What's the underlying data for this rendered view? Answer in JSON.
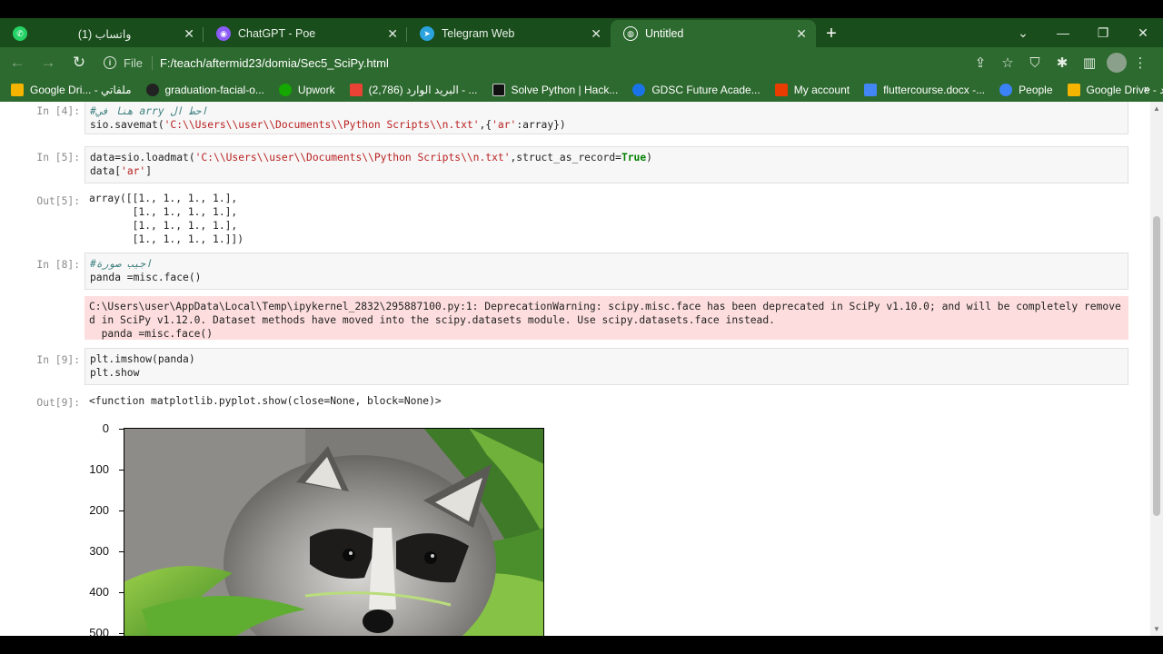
{
  "tabs": [
    {
      "label": "(1) واتساب",
      "icon": "whatsapp-icon",
      "color": "#25d366"
    },
    {
      "label": "ChatGPT - Poe",
      "icon": "poe-icon",
      "color": "#8b5cf6"
    },
    {
      "label": "Telegram Web",
      "icon": "telegram-icon",
      "color": "#2aa3df"
    },
    {
      "label": "Untitled",
      "icon": "globe-icon",
      "color": "#ffffff"
    }
  ],
  "tab_close": "✕",
  "new_tab": "+",
  "window": {
    "chevron": "⌄",
    "minimize": "—",
    "restore": "❐",
    "close": "✕"
  },
  "address": {
    "scheme": "File",
    "url": "F:/teach/aftermid23/domia/Sec5_SciPy.html"
  },
  "bookmarks": [
    {
      "label": "Google Dri... - ملفاتي",
      "icon": "google-drive-icon",
      "color": "#f4b400"
    },
    {
      "label": "graduation-facial-o...",
      "icon": "github-icon",
      "color": "#222222"
    },
    {
      "label": "Upwork",
      "icon": "upwork-icon",
      "color": "#14a800"
    },
    {
      "label": "(2,786) البريد الوارد - ...",
      "icon": "gmail-icon",
      "color": "#ea4335"
    },
    {
      "label": "Solve Python | Hack...",
      "icon": "hackerrank-icon",
      "color": "#111111"
    },
    {
      "label": "GDSC Future Acade...",
      "icon": "gdsc-icon",
      "color": "#1a73e8"
    },
    {
      "label": "My account",
      "icon": "office-icon",
      "color": "#eb3c00"
    },
    {
      "label": "fluttercourse.docx -...",
      "icon": "docs-icon",
      "color": "#4285f4"
    },
    {
      "label": "People",
      "icon": "people-icon",
      "color": "#3b82f6"
    },
    {
      "label": "Google Drive - مجلد",
      "icon": "google-drive-icon",
      "color": "#f4b400"
    }
  ],
  "bookmarks_more": "»",
  "cells": {
    "c4": {
      "prompt": "In [4]:",
      "comment": "#هنا في arry احط ال",
      "code_pre": "sio.savemat(",
      "str1": "'C:\\\\Users\\\\user\\\\Documents\\\\Python Scripts\\\\n.txt'",
      "code_mid": ",{",
      "str2": "'ar'",
      "code_post": ":array})"
    },
    "c5": {
      "prompt": "In [5]:",
      "code_pre": "data=sio.loadmat(",
      "str1": "'C:\\\\Users\\\\user\\\\Documents\\\\Python Scripts\\\\n.txt'",
      "code_mid": ",struct_as_record=",
      "kw": "True",
      "code_post": ")",
      "line2_pre": "data[",
      "line2_str": "'ar'",
      "line2_post": "]"
    },
    "o5": {
      "prompt": "Out[5]:",
      "text": "array([[1., 1., 1., 1.],\n       [1., 1., 1., 1.],\n       [1., 1., 1., 1.],\n       [1., 1., 1., 1.]])"
    },
    "c8": {
      "prompt": "In [8]:",
      "comment": "#اجيب صورة",
      "line2": "panda =misc.face()"
    },
    "e8": {
      "text": "C:\\Users\\user\\AppData\\Local\\Temp\\ipykernel_2832\\295887100.py:1: DeprecationWarning: scipy.misc.face has been deprecated in SciPy v1.10.0; and will be completely removed in SciPy v1.12.0. Dataset methods have moved into the scipy.datasets module. Use scipy.datasets.face instead.\n  panda =misc.face()"
    },
    "c9": {
      "prompt": "In [9]:",
      "text": "plt.imshow(panda)\nplt.show"
    },
    "o9": {
      "prompt": "Out[9]:",
      "text": "<function matplotlib.pyplot.show(close=None, block=None)>"
    }
  },
  "plot": {
    "yticks": [
      "0",
      "100",
      "200",
      "300",
      "400",
      "500"
    ]
  }
}
